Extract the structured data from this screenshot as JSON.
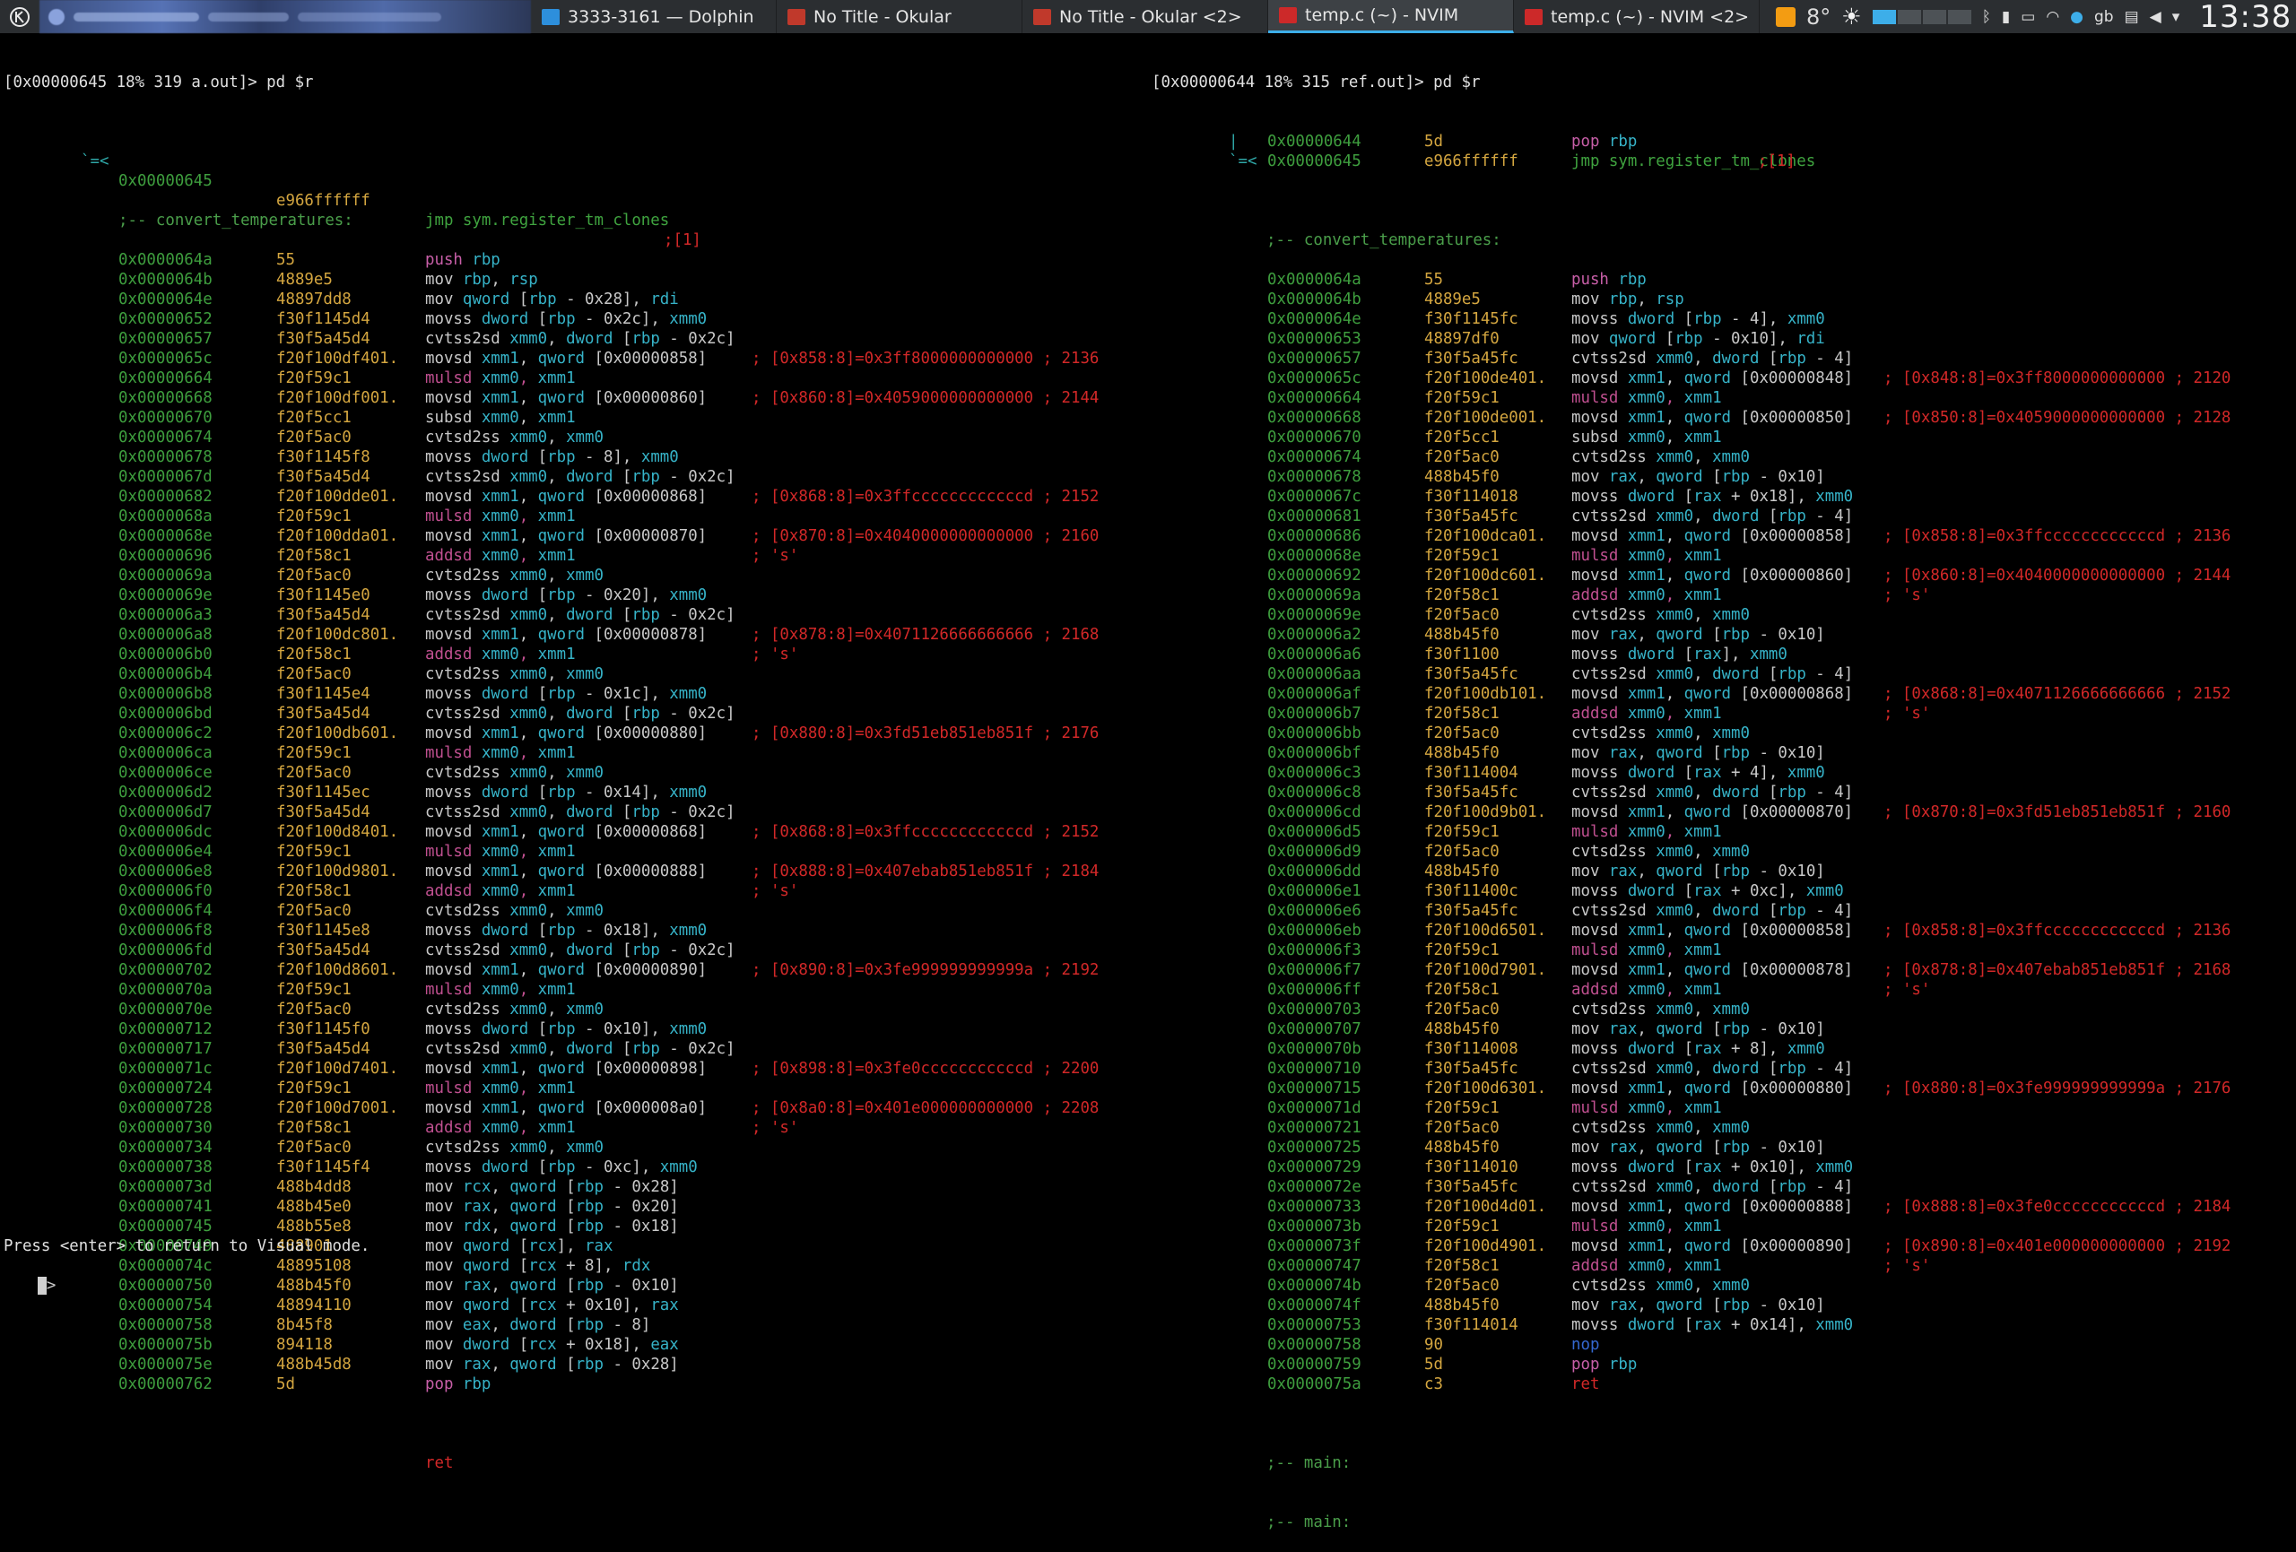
{
  "taskbar": {
    "tasks": [
      {
        "label": "3333-3161 — Dolphin",
        "icon": "dolphin-icon"
      },
      {
        "label": "No Title - Okular",
        "icon": "okular-icon"
      },
      {
        "label": "No Title - Okular <2>",
        "icon": "okular-icon"
      },
      {
        "label": "temp.c (~) - NVIM",
        "icon": "nvim-icon"
      },
      {
        "label": "temp.c (~) - NVIM <2>",
        "icon": "nvim-icon"
      }
    ],
    "active_task_index": 3,
    "temperature": "8°",
    "keyboard_layout": "gb",
    "clock": "13:38"
  },
  "left": {
    "prompt": "[0x00000645 18% 319 a.out]> pd $r",
    "jump_line": {
      "arrow": "`=<",
      "addr": "0x00000645",
      "bytes": "e966ffffff",
      "ins": "jmp sym.register_tm_clones",
      "cmt": ";[1]"
    },
    "func_label": ";-- convert_temperatures:",
    "rows": [
      [
        "0x0000064a",
        "55",
        "push rbp",
        ""
      ],
      [
        "0x0000064b",
        "4889e5",
        "mov rbp, rsp",
        ""
      ],
      [
        "0x0000064e",
        "48897dd8",
        "mov qword [rbp - 0x28], rdi",
        ""
      ],
      [
        "0x00000652",
        "f30f1145d4",
        "movss dword [rbp - 0x2c], xmm0",
        ""
      ],
      [
        "0x00000657",
        "f30f5a45d4",
        "cvtss2sd xmm0, dword [rbp - 0x2c]",
        ""
      ],
      [
        "0x0000065c",
        "f20f100df401.",
        "movsd xmm1, qword [0x00000858]",
        "; [0x858:8]=0x3ff8000000000000 ; 2136"
      ],
      [
        "0x00000664",
        "f20f59c1",
        "mulsd xmm0, xmm1",
        ""
      ],
      [
        "0x00000668",
        "f20f100df001.",
        "movsd xmm1, qword [0x00000860]",
        "; [0x860:8]=0x4059000000000000 ; 2144"
      ],
      [
        "0x00000670",
        "f20f5cc1",
        "subsd xmm0, xmm1",
        ""
      ],
      [
        "0x00000674",
        "f20f5ac0",
        "cvtsd2ss xmm0, xmm0",
        ""
      ],
      [
        "0x00000678",
        "f30f1145f8",
        "movss dword [rbp - 8], xmm0",
        ""
      ],
      [
        "0x0000067d",
        "f30f5a45d4",
        "cvtss2sd xmm0, dword [rbp - 0x2c]",
        ""
      ],
      [
        "0x00000682",
        "f20f100dde01.",
        "movsd xmm1, qword [0x00000868]",
        "; [0x868:8]=0x3ffccccccccccccd ; 2152"
      ],
      [
        "0x0000068a",
        "f20f59c1",
        "mulsd xmm0, xmm1",
        ""
      ],
      [
        "0x0000068e",
        "f20f100dda01.",
        "movsd xmm1, qword [0x00000870]",
        "; [0x870:8]=0x4040000000000000 ; 2160"
      ],
      [
        "0x00000696",
        "f20f58c1",
        "addsd xmm0, xmm1",
        "; 's'"
      ],
      [
        "0x0000069a",
        "f20f5ac0",
        "cvtsd2ss xmm0, xmm0",
        ""
      ],
      [
        "0x0000069e",
        "f30f1145e0",
        "movss dword [rbp - 0x20], xmm0",
        ""
      ],
      [
        "0x000006a3",
        "f30f5a45d4",
        "cvtss2sd xmm0, dword [rbp - 0x2c]",
        ""
      ],
      [
        "0x000006a8",
        "f20f100dc801.",
        "movsd xmm1, qword [0x00000878]",
        "; [0x878:8]=0x4071126666666666 ; 2168"
      ],
      [
        "0x000006b0",
        "f20f58c1",
        "addsd xmm0, xmm1",
        "; 's'"
      ],
      [
        "0x000006b4",
        "f20f5ac0",
        "cvtsd2ss xmm0, xmm0",
        ""
      ],
      [
        "0x000006b8",
        "f30f1145e4",
        "movss dword [rbp - 0x1c], xmm0",
        ""
      ],
      [
        "0x000006bd",
        "f30f5a45d4",
        "cvtss2sd xmm0, dword [rbp - 0x2c]",
        ""
      ],
      [
        "0x000006c2",
        "f20f100db601.",
        "movsd xmm1, qword [0x00000880]",
        "; [0x880:8]=0x3fd51eb851eb851f ; 2176"
      ],
      [
        "0x000006ca",
        "f20f59c1",
        "mulsd xmm0, xmm1",
        ""
      ],
      [
        "0x000006ce",
        "f20f5ac0",
        "cvtsd2ss xmm0, xmm0",
        ""
      ],
      [
        "0x000006d2",
        "f30f1145ec",
        "movss dword [rbp - 0x14], xmm0",
        ""
      ],
      [
        "0x000006d7",
        "f30f5a45d4",
        "cvtss2sd xmm0, dword [rbp - 0x2c]",
        ""
      ],
      [
        "0x000006dc",
        "f20f100d8401.",
        "movsd xmm1, qword [0x00000868]",
        "; [0x868:8]=0x3ffccccccccccccd ; 2152"
      ],
      [
        "0x000006e4",
        "f20f59c1",
        "mulsd xmm0, xmm1",
        ""
      ],
      [
        "0x000006e8",
        "f20f100d9801.",
        "movsd xmm1, qword [0x00000888]",
        "; [0x888:8]=0x407ebab851eb851f ; 2184"
      ],
      [
        "0x000006f0",
        "f20f58c1",
        "addsd xmm0, xmm1",
        "; 's'"
      ],
      [
        "0x000006f4",
        "f20f5ac0",
        "cvtsd2ss xmm0, xmm0",
        ""
      ],
      [
        "0x000006f8",
        "f30f1145e8",
        "movss dword [rbp - 0x18], xmm0",
        ""
      ],
      [
        "0x000006fd",
        "f30f5a45d4",
        "cvtss2sd xmm0, dword [rbp - 0x2c]",
        ""
      ],
      [
        "0x00000702",
        "f20f100d8601.",
        "movsd xmm1, qword [0x00000890]",
        "; [0x890:8]=0x3fe999999999999a ; 2192"
      ],
      [
        "0x0000070a",
        "f20f59c1",
        "mulsd xmm0, xmm1",
        ""
      ],
      [
        "0x0000070e",
        "f20f5ac0",
        "cvtsd2ss xmm0, xmm0",
        ""
      ],
      [
        "0x00000712",
        "f30f1145f0",
        "movss dword [rbp - 0x10], xmm0",
        ""
      ],
      [
        "0x00000717",
        "f30f5a45d4",
        "cvtss2sd xmm0, dword [rbp - 0x2c]",
        ""
      ],
      [
        "0x0000071c",
        "f20f100d7401.",
        "movsd xmm1, qword [0x00000898]",
        "; [0x898:8]=0x3fe0cccccccccccd ; 2200"
      ],
      [
        "0x00000724",
        "f20f59c1",
        "mulsd xmm0, xmm1",
        ""
      ],
      [
        "0x00000728",
        "f20f100d7001.",
        "movsd xmm1, qword [0x000008a0]",
        "; [0x8a0:8]=0x401e000000000000 ; 2208"
      ],
      [
        "0x00000730",
        "f20f58c1",
        "addsd xmm0, xmm1",
        "; 's'"
      ],
      [
        "0x00000734",
        "f20f5ac0",
        "cvtsd2ss xmm0, xmm0",
        ""
      ],
      [
        "0x00000738",
        "f30f1145f4",
        "movss dword [rbp - 0xc], xmm0",
        ""
      ],
      [
        "0x0000073d",
        "488b4dd8",
        "mov rcx, qword [rbp - 0x28]",
        ""
      ],
      [
        "0x00000741",
        "488b45e0",
        "mov rax, qword [rbp - 0x20]",
        ""
      ],
      [
        "0x00000745",
        "488b55e8",
        "mov rdx, qword [rbp - 0x18]",
        ""
      ],
      [
        "0x00000749",
        "488901",
        "mov qword [rcx], rax",
        ""
      ],
      [
        "0x0000074c",
        "48895108",
        "mov qword [rcx + 8], rdx",
        ""
      ],
      [
        "0x00000750",
        "488b45f0",
        "mov rax, qword [rbp - 0x10]",
        ""
      ],
      [
        "0x00000754",
        "48894110",
        "mov qword [rcx + 0x10], rax",
        ""
      ],
      [
        "0x00000758",
        "8b45f8",
        "mov eax, dword [rbp - 8]",
        ""
      ],
      [
        "0x0000075b",
        "894118",
        "mov dword [rcx + 0x18], eax",
        ""
      ],
      [
        "0x0000075e",
        "488b45d8",
        "mov rax, qword [rbp - 0x28]",
        ""
      ],
      [
        "0x00000762",
        "5d",
        "pop rbp",
        ""
      ]
    ],
    "ret_line": "ret",
    "status": "Press <enter> to return to Visual mode.",
    "cursor_prompt": ":>"
  },
  "right": {
    "prompt": "[0x00000644 18% 315 ref.out]> pd $r",
    "pre_rows": [
      {
        "arrow": "|",
        "addr": "0x00000644",
        "bytes": "5d",
        "ins": "pop rbp",
        "cmt": ""
      },
      {
        "arrow": "`=<",
        "addr": "0x00000645",
        "bytes": "e966ffffff",
        "ins": "jmp sym.register_tm_clones",
        "cmt": ";[1]"
      }
    ],
    "func_label": ";-- convert_temperatures:",
    "rows": [
      [
        "0x0000064a",
        "55",
        "push rbp",
        ""
      ],
      [
        "0x0000064b",
        "4889e5",
        "mov rbp, rsp",
        ""
      ],
      [
        "0x0000064e",
        "f30f1145fc",
        "movss dword [rbp - 4], xmm0",
        ""
      ],
      [
        "0x00000653",
        "48897df0",
        "mov qword [rbp - 0x10], rdi",
        ""
      ],
      [
        "0x00000657",
        "f30f5a45fc",
        "cvtss2sd xmm0, dword [rbp - 4]",
        ""
      ],
      [
        "0x0000065c",
        "f20f100de401.",
        "movsd xmm1, qword [0x00000848]",
        "; [0x848:8]=0x3ff8000000000000 ; 2120"
      ],
      [
        "0x00000664",
        "f20f59c1",
        "mulsd xmm0, xmm1",
        ""
      ],
      [
        "0x00000668",
        "f20f100de001.",
        "movsd xmm1, qword [0x00000850]",
        "; [0x850:8]=0x4059000000000000 ; 2128"
      ],
      [
        "0x00000670",
        "f20f5cc1",
        "subsd xmm0, xmm1",
        ""
      ],
      [
        "0x00000674",
        "f20f5ac0",
        "cvtsd2ss xmm0, xmm0",
        ""
      ],
      [
        "0x00000678",
        "488b45f0",
        "mov rax, qword [rbp - 0x10]",
        ""
      ],
      [
        "0x0000067c",
        "f30f114018",
        "movss dword [rax + 0x18], xmm0",
        ""
      ],
      [
        "0x00000681",
        "f30f5a45fc",
        "cvtss2sd xmm0, dword [rbp - 4]",
        ""
      ],
      [
        "0x00000686",
        "f20f100dca01.",
        "movsd xmm1, qword [0x00000858]",
        "; [0x858:8]=0x3ffccccccccccccd ; 2136"
      ],
      [
        "0x0000068e",
        "f20f59c1",
        "mulsd xmm0, xmm1",
        ""
      ],
      [
        "0x00000692",
        "f20f100dc601.",
        "movsd xmm1, qword [0x00000860]",
        "; [0x860:8]=0x4040000000000000 ; 2144"
      ],
      [
        "0x0000069a",
        "f20f58c1",
        "addsd xmm0, xmm1",
        "; 's'"
      ],
      [
        "0x0000069e",
        "f20f5ac0",
        "cvtsd2ss xmm0, xmm0",
        ""
      ],
      [
        "0x000006a2",
        "488b45f0",
        "mov rax, qword [rbp - 0x10]",
        ""
      ],
      [
        "0x000006a6",
        "f30f1100",
        "movss dword [rax], xmm0",
        ""
      ],
      [
        "0x000006aa",
        "f30f5a45fc",
        "cvtss2sd xmm0, dword [rbp - 4]",
        ""
      ],
      [
        "0x000006af",
        "f20f100db101.",
        "movsd xmm1, qword [0x00000868]",
        "; [0x868:8]=0x4071126666666666 ; 2152"
      ],
      [
        "0x000006b7",
        "f20f58c1",
        "addsd xmm0, xmm1",
        "; 's'"
      ],
      [
        "0x000006bb",
        "f20f5ac0",
        "cvtsd2ss xmm0, xmm0",
        ""
      ],
      [
        "0x000006bf",
        "488b45f0",
        "mov rax, qword [rbp - 0x10]",
        ""
      ],
      [
        "0x000006c3",
        "f30f114004",
        "movss dword [rax + 4], xmm0",
        ""
      ],
      [
        "0x000006c8",
        "f30f5a45fc",
        "cvtss2sd xmm0, dword [rbp - 4]",
        ""
      ],
      [
        "0x000006cd",
        "f20f100d9b01.",
        "movsd xmm1, qword [0x00000870]",
        "; [0x870:8]=0x3fd51eb851eb851f ; 2160"
      ],
      [
        "0x000006d5",
        "f20f59c1",
        "mulsd xmm0, xmm1",
        ""
      ],
      [
        "0x000006d9",
        "f20f5ac0",
        "cvtsd2ss xmm0, xmm0",
        ""
      ],
      [
        "0x000006dd",
        "488b45f0",
        "mov rax, qword [rbp - 0x10]",
        ""
      ],
      [
        "0x000006e1",
        "f30f11400c",
        "movss dword [rax + 0xc], xmm0",
        ""
      ],
      [
        "0x000006e6",
        "f30f5a45fc",
        "cvtss2sd xmm0, dword [rbp - 4]",
        ""
      ],
      [
        "0x000006eb",
        "f20f100d6501.",
        "movsd xmm1, qword [0x00000858]",
        "; [0x858:8]=0x3ffccccccccccccd ; 2136"
      ],
      [
        "0x000006f3",
        "f20f59c1",
        "mulsd xmm0, xmm1",
        ""
      ],
      [
        "0x000006f7",
        "f20f100d7901.",
        "movsd xmm1, qword [0x00000878]",
        "; [0x878:8]=0x407ebab851eb851f ; 2168"
      ],
      [
        "0x000006ff",
        "f20f58c1",
        "addsd xmm0, xmm1",
        "; 's'"
      ],
      [
        "0x00000703",
        "f20f5ac0",
        "cvtsd2ss xmm0, xmm0",
        ""
      ],
      [
        "0x00000707",
        "488b45f0",
        "mov rax, qword [rbp - 0x10]",
        ""
      ],
      [
        "0x0000070b",
        "f30f114008",
        "movss dword [rax + 8], xmm0",
        ""
      ],
      [
        "0x00000710",
        "f30f5a45fc",
        "cvtss2sd xmm0, dword [rbp - 4]",
        ""
      ],
      [
        "0x00000715",
        "f20f100d6301.",
        "movsd xmm1, qword [0x00000880]",
        "; [0x880:8]=0x3fe999999999999a ; 2176"
      ],
      [
        "0x0000071d",
        "f20f59c1",
        "mulsd xmm0, xmm1",
        ""
      ],
      [
        "0x00000721",
        "f20f5ac0",
        "cvtsd2ss xmm0, xmm0",
        ""
      ],
      [
        "0x00000725",
        "488b45f0",
        "mov rax, qword [rbp - 0x10]",
        ""
      ],
      [
        "0x00000729",
        "f30f114010",
        "movss dword [rax + 0x10], xmm0",
        ""
      ],
      [
        "0x0000072e",
        "f30f5a45fc",
        "cvtss2sd xmm0, dword [rbp - 4]",
        ""
      ],
      [
        "0x00000733",
        "f20f100d4d01.",
        "movsd xmm1, qword [0x00000888]",
        "; [0x888:8]=0x3fe0cccccccccccd ; 2184"
      ],
      [
        "0x0000073b",
        "f20f59c1",
        "mulsd xmm0, xmm1",
        ""
      ],
      [
        "0x0000073f",
        "f20f100d4901.",
        "movsd xmm1, qword [0x00000890]",
        "; [0x890:8]=0x401e000000000000 ; 2192"
      ],
      [
        "0x00000747",
        "f20f58c1",
        "addsd xmm0, xmm1",
        "; 's'"
      ],
      [
        "0x0000074b",
        "f20f5ac0",
        "cvtsd2ss xmm0, xmm0",
        ""
      ],
      [
        "0x0000074f",
        "488b45f0",
        "mov rax, qword [rbp - 0x10]",
        ""
      ],
      [
        "0x00000753",
        "f30f114014",
        "movss dword [rax + 0x14], xmm0",
        ""
      ],
      [
        "0x00000758",
        "90",
        "nop",
        ""
      ],
      [
        "0x00000759",
        "5d",
        "pop rbp",
        ""
      ],
      [
        "0x0000075a",
        "c3",
        "ret",
        ""
      ]
    ],
    "main_labels": [
      ";-- main:",
      ";-- main:"
    ]
  }
}
